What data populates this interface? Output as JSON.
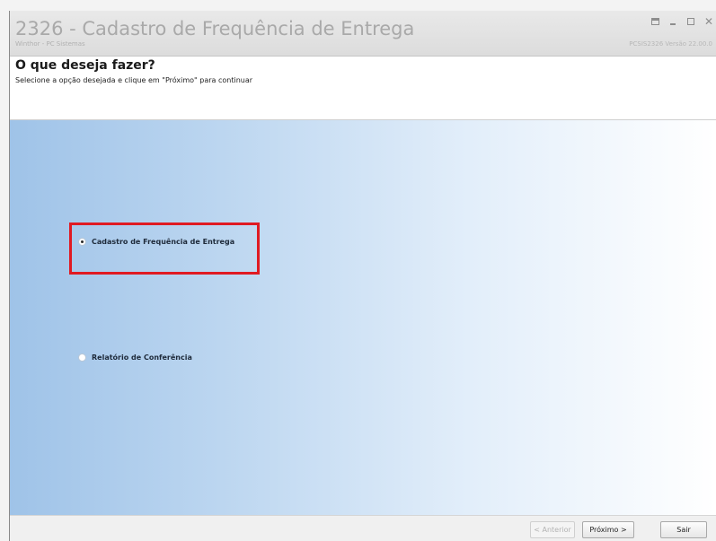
{
  "window": {
    "title": "2326 - Cadastro de Frequência de Entrega",
    "subtitle": "Winthor - PC Sistemas",
    "version": "PCSIS2326  Versão 22.00.0"
  },
  "header": {
    "heading": "O que deseja fazer?",
    "instruction": "Selecione a opção desejada e clique em \"Próximo\" para continuar"
  },
  "options": [
    {
      "label": "Cadastro de Frequência de Entrega",
      "selected": true
    },
    {
      "label": "Relatório de Conferência",
      "selected": false
    }
  ],
  "footer": {
    "back_label": "< Anterior",
    "next_label": "Próximo >",
    "exit_label": "Sair"
  },
  "colors": {
    "highlight": "#e01a22",
    "gradient_start": "#9fc3e8",
    "gradient_end": "#ffffff"
  }
}
